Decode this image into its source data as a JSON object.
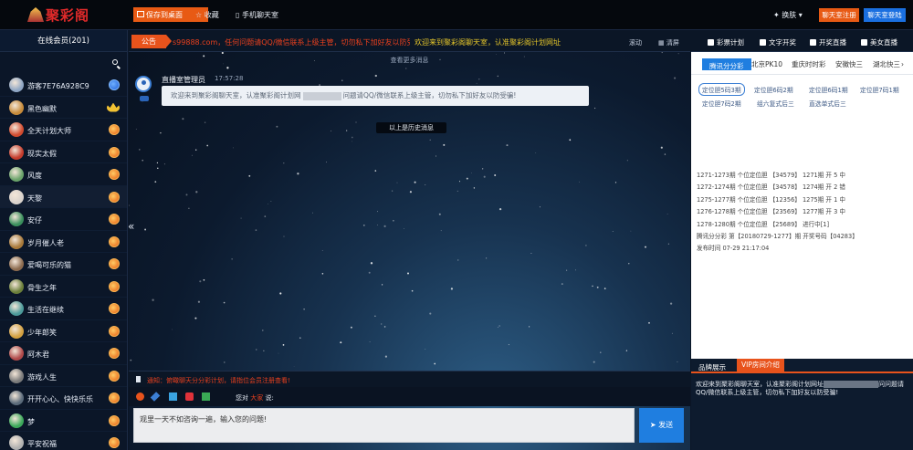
{
  "header": {
    "logo_text": "聚彩阁",
    "save_desktop": "保存到桌面",
    "favorite": "收藏",
    "mobile_chat": "手机聊天室",
    "skin": "换肤",
    "register": "聊天室注册",
    "login": "聊天室登陆"
  },
  "sidebar": {
    "title": "在线会员(201)",
    "users": [
      {
        "name": "游客7E76A928C9",
        "badge": "blue",
        "avatar": "#8fa6c4"
      },
      {
        "name": "黑色幽默",
        "badge": "crown",
        "avatar": "#c78b3a"
      },
      {
        "name": "全天计划大师",
        "badge": "orange",
        "avatar": "#d14b2f"
      },
      {
        "name": "现实太假",
        "badge": "orange",
        "avatar": "#c53c2c"
      },
      {
        "name": "风度",
        "badge": "orange",
        "avatar": "#6aa36a"
      },
      {
        "name": "天黎",
        "badge": "orange",
        "avatar": "#d9d2cc"
      },
      {
        "name": "安仔",
        "badge": "orange",
        "avatar": "#3a8f5c"
      },
      {
        "name": "岁月催人老",
        "badge": "orange",
        "avatar": "#a8793a"
      },
      {
        "name": "爱喝可乐的猫",
        "badge": "orange",
        "avatar": "#8c6b4f"
      },
      {
        "name": "骨生之年",
        "badge": "orange",
        "avatar": "#6b7f3a"
      },
      {
        "name": "生活在继续",
        "badge": "orange",
        "avatar": "#4c9a9a"
      },
      {
        "name": "少年郎笑",
        "badge": "orange",
        "avatar": "#d3a040"
      },
      {
        "name": "阿木君",
        "badge": "orange",
        "avatar": "#b04a4a"
      },
      {
        "name": "游戏人生",
        "badge": "orange",
        "avatar": "#7a7a7a"
      },
      {
        "name": "开开心心、快快乐乐",
        "badge": "orange",
        "avatar": "#5a6a7a"
      },
      {
        "name": "梦",
        "badge": "orange",
        "avatar": "#3ca85a"
      },
      {
        "name": "平安祝福",
        "badge": "orange",
        "avatar": "#b0b0b0"
      }
    ]
  },
  "marquee": {
    "label": "公告",
    "text_red": "s99888.com，任何问题请QQ/微信联系上级主管，切勿私下加好友以防受骗!",
    "text_yellow": "欢迎来到聚彩阁聊天室，认准聚彩阁计划网址",
    "scroll": "滚动",
    "clear": "清屏"
  },
  "chat": {
    "view_more": "查看更多消息",
    "sender": "直播室管理员",
    "time": "17:57:28",
    "message_a": "欢迎来到聚彩阁聊天室，认准聚彩阁计划网",
    "message_b": "问题请QQ/微信联系上级主管，切勿私下加好友以防受骗!",
    "history": "以上是历史消息",
    "notice": "通知：俯瞰聊天分分彩计划，请指位会员注册查看!",
    "to_label": "您对",
    "to_target": "大家",
    "to_suffix": "说:",
    "input_value": "观里一天不如咨询一遍，输入您的问题!",
    "send": "发送"
  },
  "right_panel": {
    "tabs": [
      "彩票计划",
      "文字开奖",
      "开奖直播",
      "美女直播"
    ],
    "lottery_tabs": [
      "腾讯分分彩",
      "北京PK10",
      "重庆时时彩",
      "安徽快三",
      "湖北快三"
    ],
    "positions": [
      "定位胆5码3期",
      "定位胆6码2期",
      "定位胆6码1期",
      "定位胆7码1期",
      "定位胆7码2期",
      "组六复式后三",
      "直选单式后三"
    ],
    "results": [
      "1271-1273期 个位定位胆 【34579】 1271期 开 5 中",
      "1272-1274期 个位定位胆 【34578】 1274期 开 2 错",
      "1275-1277期 个位定位胆 【12356】 1275期 开 1 中",
      "1276-1278期 个位定位胆 【23569】 1277期 开 3 中",
      "1278-1280期 个位定位胆 【25689】 进行中[1]",
      "腾讯分分彩 第【20180729-1277】期 开奖号码【04283】",
      "发布时间 07-29 21:17:04"
    ],
    "bottom_tabs": [
      "品牌展示",
      "VIP房间介绍"
    ],
    "bottom_text_a": "欢迎来到聚彩阁聊天室，认准聚彩阁计划网址",
    "bottom_text_b": "问问题请QQ/微信联系上级主管，切勿私下加好友以防受骗!"
  },
  "colors": {
    "accent": "#e8531c",
    "blue": "#1f7ee0"
  }
}
